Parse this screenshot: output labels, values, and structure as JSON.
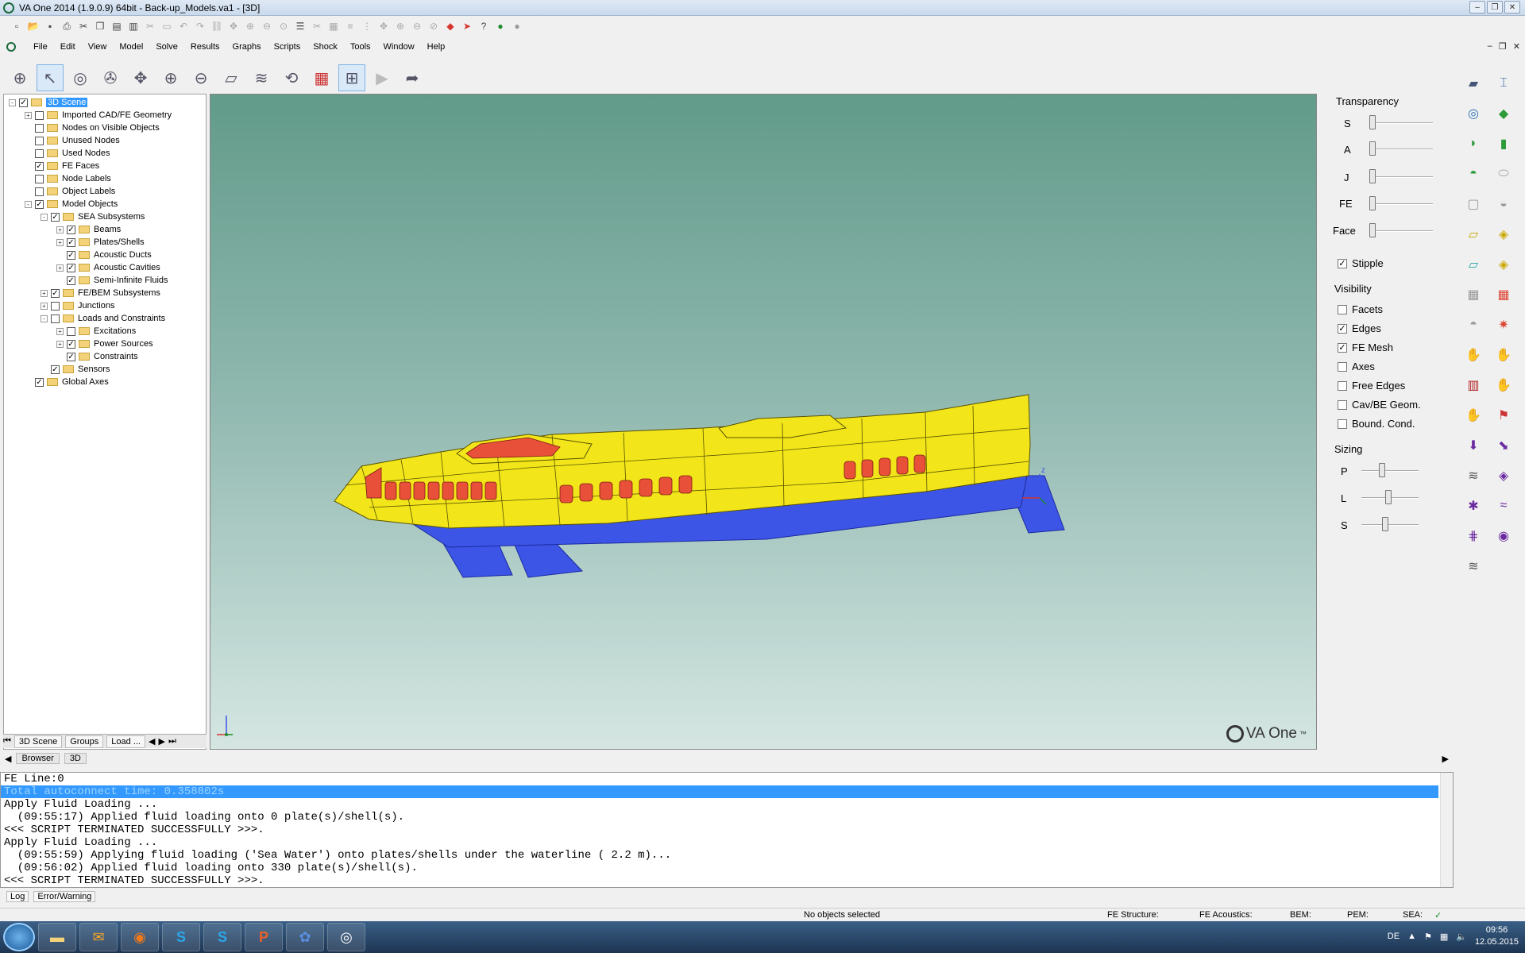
{
  "window": {
    "title": "VA One 2014 (1.9.0.9) 64bit - Back-up_Models.va1 - [3D]",
    "controls": [
      "–",
      "❐",
      "✕"
    ]
  },
  "menu": [
    "File",
    "Edit",
    "View",
    "Model",
    "Solve",
    "Results",
    "Graphs",
    "Scripts",
    "Shock",
    "Tools",
    "Window",
    "Help"
  ],
  "mdi_controls": [
    "–",
    "❐",
    "✕"
  ],
  "toolbar1_icons": [
    "new-icon",
    "open-icon",
    "save-icon",
    "print-icon",
    "print-preview-icon",
    "cut-icon",
    "copy-icon",
    "paste-icon",
    "paste-special-icon",
    "undo-icon",
    "redo-icon",
    "zoom-in-icon",
    "zoom-out-icon",
    "run-icon",
    "stop-icon",
    "help-icon",
    "go-icon"
  ],
  "tree": {
    "root": "3D Scene",
    "items": [
      {
        "label": "Imported CAD/FE Geometry",
        "level": 1,
        "checked": false,
        "expander": "+"
      },
      {
        "label": "Nodes on Visible Objects",
        "level": 1,
        "checked": false,
        "expander": ""
      },
      {
        "label": "Unused Nodes",
        "level": 1,
        "checked": false,
        "expander": ""
      },
      {
        "label": "Used Nodes",
        "level": 1,
        "checked": false,
        "expander": ""
      },
      {
        "label": "FE Faces",
        "level": 1,
        "checked": true,
        "expander": ""
      },
      {
        "label": "Node Labels",
        "level": 1,
        "checked": false,
        "expander": ""
      },
      {
        "label": "Object Labels",
        "level": 1,
        "checked": false,
        "expander": ""
      },
      {
        "label": "Model Objects",
        "level": 1,
        "checked": true,
        "expander": "-"
      },
      {
        "label": "SEA Subsystems",
        "level": 2,
        "checked": true,
        "expander": "-"
      },
      {
        "label": "Beams",
        "level": 3,
        "checked": true,
        "expander": "+"
      },
      {
        "label": "Plates/Shells",
        "level": 3,
        "checked": true,
        "expander": "+"
      },
      {
        "label": "Acoustic Ducts",
        "level": 3,
        "checked": true,
        "expander": ""
      },
      {
        "label": "Acoustic Cavities",
        "level": 3,
        "checked": true,
        "expander": "+"
      },
      {
        "label": "Semi-Infinite Fluids",
        "level": 3,
        "checked": true,
        "expander": ""
      },
      {
        "label": "FE/BEM Subsystems",
        "level": 2,
        "checked": true,
        "expander": "+"
      },
      {
        "label": "Junctions",
        "level": 2,
        "checked": false,
        "expander": "+"
      },
      {
        "label": "Loads and Constraints",
        "level": 2,
        "checked": false,
        "expander": "-"
      },
      {
        "label": "Excitations",
        "level": 3,
        "checked": false,
        "expander": "+"
      },
      {
        "label": "Power Sources",
        "level": 3,
        "checked": true,
        "expander": "+"
      },
      {
        "label": "Constraints",
        "level": 3,
        "checked": true,
        "expander": ""
      },
      {
        "label": "Sensors",
        "level": 2,
        "checked": true,
        "expander": ""
      },
      {
        "label": "Global Axes",
        "level": 1,
        "checked": true,
        "expander": ""
      }
    ]
  },
  "tree_tabs": [
    "3D Scene",
    "Groups",
    "Load ..."
  ],
  "right_panel": {
    "transparency_title": "Transparency",
    "transparency_sliders": [
      "S",
      "A",
      "J",
      "FE",
      "Face"
    ],
    "stipple": {
      "label": "Stipple",
      "checked": true
    },
    "visibility_title": "Visibility",
    "visibility": [
      {
        "label": "Facets",
        "checked": false
      },
      {
        "label": "Edges",
        "checked": true
      },
      {
        "label": "FE Mesh",
        "checked": true
      },
      {
        "label": "Axes",
        "checked": false
      },
      {
        "label": "Free Edges",
        "checked": false
      },
      {
        "label": "Cav/BE Geom.",
        "checked": false
      },
      {
        "label": "Bound. Cond.",
        "checked": false
      }
    ],
    "sizing_title": "Sizing",
    "sizing_sliders": [
      "P",
      "L",
      "S"
    ]
  },
  "viewport": {
    "logo_text": "VA One",
    "logo_mark": "™",
    "axis_labels": {
      "z": "z",
      "x": "x",
      "y": "y"
    },
    "colors": {
      "hull": "#f2e61a",
      "windows": "#e8503a",
      "foils": "#3c55e6"
    }
  },
  "browser_tabs": [
    "Browser",
    "3D"
  ],
  "log": {
    "lines": [
      "FE Line:0",
      "Total autoconnect time: 0.358802s",
      "Apply Fluid Loading ...",
      "  (09:55:17) Applied fluid loading onto 0 plate(s)/shell(s).",
      "<<< SCRIPT TERMINATED SUCCESSFULLY >>>.",
      "Apply Fluid Loading ...",
      "  (09:55:59) Applying fluid loading ('Sea Water') onto plates/shells under the waterline ( 2.2 m)...",
      "  (09:56:02) Applied fluid loading onto 330 plate(s)/shell(s).",
      "<<< SCRIPT TERMINATED SUCCESSFULLY >>>."
    ],
    "tabs": [
      "Log",
      "Error/Warning"
    ]
  },
  "status": {
    "selection": "No objects selected",
    "fe_structure": "FE Structure:",
    "fe_acoustics": "FE Acoustics:",
    "bem": "BEM:",
    "pem": "PEM:",
    "sea": "SEA:",
    "sea_ok": "✓"
  },
  "taskbar": {
    "apps": [
      "folder",
      "outlook",
      "firefox",
      "S",
      "S",
      "P",
      "flower",
      "VA"
    ],
    "lang": "DE",
    "time": "09:56",
    "date": "12.05.2015"
  }
}
